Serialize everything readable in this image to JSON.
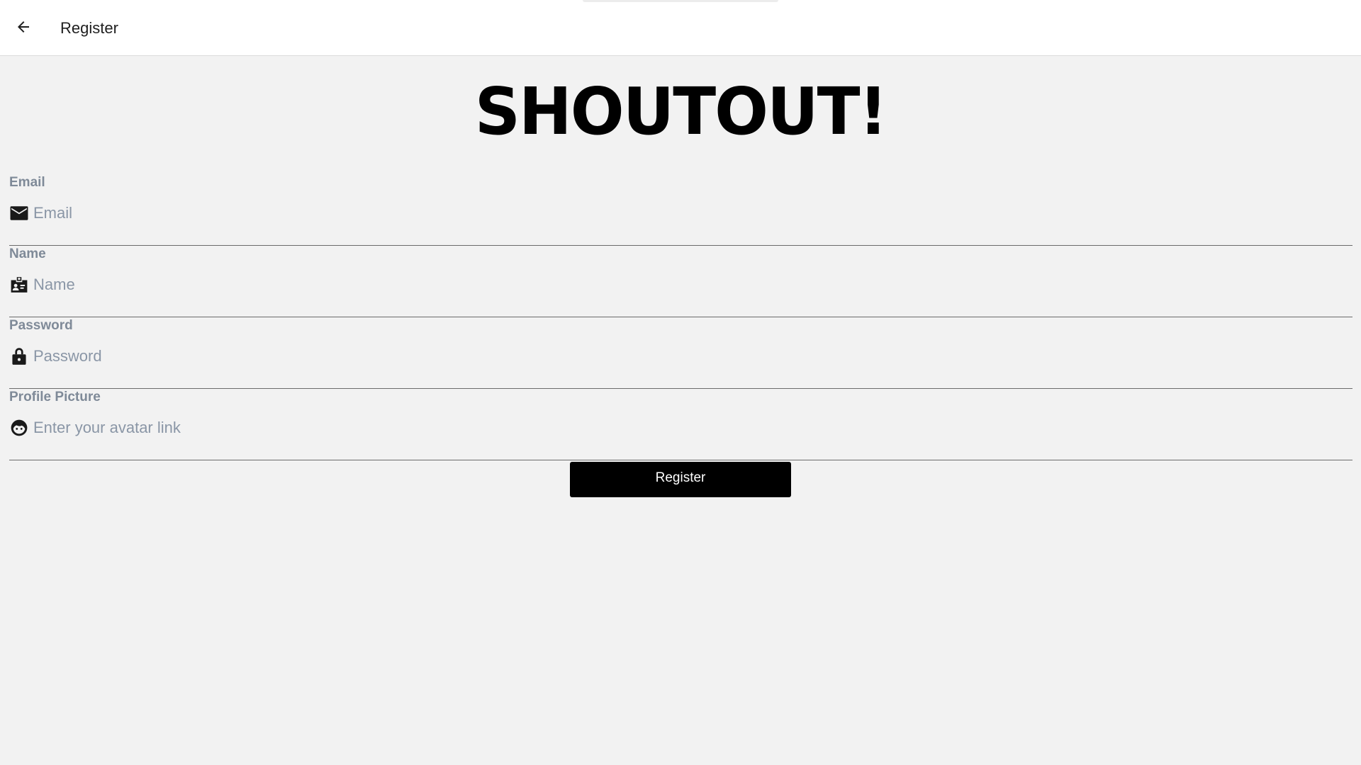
{
  "header": {
    "title": "Register",
    "back_icon": "arrow-left-icon"
  },
  "app": {
    "logo_text": "SHOUTOUT!"
  },
  "form": {
    "fields": [
      {
        "label": "Email",
        "placeholder": "Email",
        "value": "",
        "icon": "envelope-icon"
      },
      {
        "label": "Name",
        "placeholder": "Name",
        "value": "",
        "icon": "id-badge-icon"
      },
      {
        "label": "Password",
        "placeholder": "Password",
        "value": "",
        "icon": "lock-icon"
      },
      {
        "label": "Profile Picture",
        "placeholder": "Enter your avatar link",
        "value": "",
        "icon": "face-icon"
      }
    ],
    "submit_label": "Register"
  },
  "colors": {
    "background": "#f2f2f2",
    "topbar": "#ffffff",
    "label": "#7f8a98",
    "placeholder": "#8a96a6",
    "button": "#000000",
    "button_text": "#ffffff"
  }
}
